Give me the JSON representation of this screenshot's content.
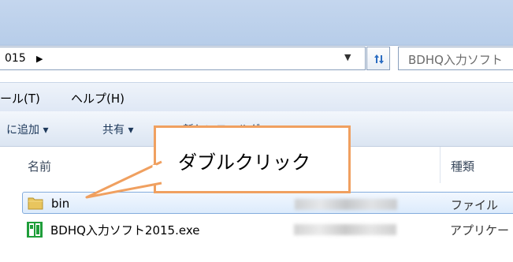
{
  "address": {
    "path_tail": "015",
    "dropdown_icon": "chevron-down"
  },
  "search": {
    "placeholder": "BDHQ入力ソフト"
  },
  "menu": {
    "tools": "ール(T)",
    "help": "ヘルプ(H)"
  },
  "toolbar": {
    "add_to_library": "に追加 ▾",
    "share": "共有 ▾",
    "new_folder": "新しいフォルダー"
  },
  "columns": {
    "name": "名前",
    "type": "種類"
  },
  "files": [
    {
      "name": "bin",
      "type": "ファイル",
      "icon": "folder-icon",
      "selected": true
    },
    {
      "name": "BDHQ入力ソフト2015.exe",
      "type": "アプリケー",
      "icon": "exe-icon",
      "selected": false
    }
  ],
  "callout": {
    "text": "ダブルクリック"
  },
  "colors": {
    "callout_border": "#f0a060",
    "selection": "#dcebfc"
  }
}
